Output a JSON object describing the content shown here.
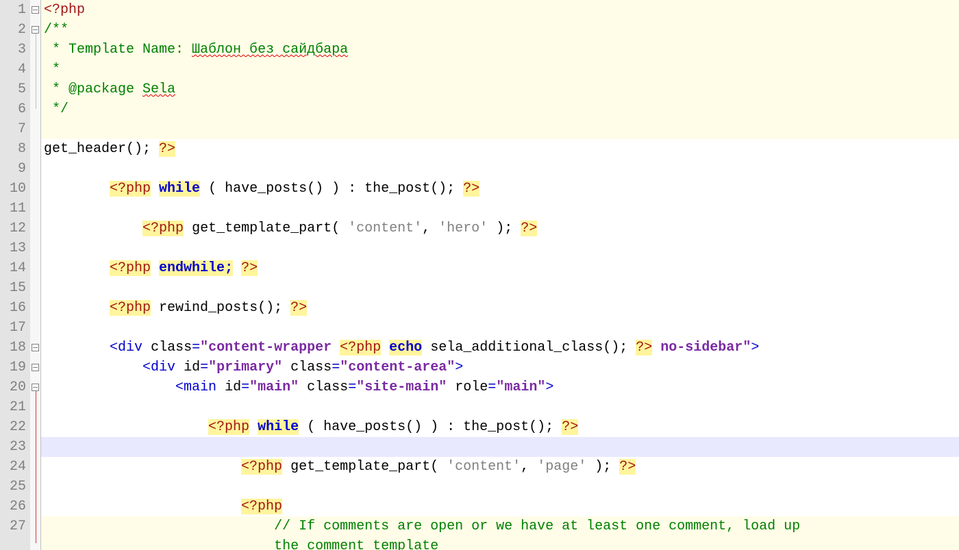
{
  "lines": {
    "open_tag": "<?php",
    "c1": "/**",
    "c2_prefix": " * Template Name: ",
    "c2_boxed": "Шаблон без сайдбара",
    "c3": " *",
    "c4_prefix": " * @package ",
    "c4_pkg": "Sela",
    "c5": " */",
    "l8_func": "get_header",
    "l8_rest": "(); ",
    "l8_close": "?>",
    "while_kw": "while",
    "have_posts": "have_posts",
    "the_post": "the_post",
    "get_template_part": "get_template_part",
    "content_str": "'content'",
    "hero_str": "'hero'",
    "page_str": "'page'",
    "endwhile": "endwhile;",
    "rewind_posts": "rewind_posts",
    "echo_kw": "echo",
    "sela_fn": "sela_additional_class",
    "no_sidebar": " no-sidebar",
    "div": "div",
    "main": "main",
    "class_attr": "class",
    "id_attr": "id",
    "role_attr": "role",
    "content_wrapper": "content-wrapper ",
    "primary": "primary",
    "content_area": "content-area",
    "main_val": "main",
    "site_main": "site-main",
    "comment1": "// If comments are open or we have at least one comment, load up",
    "comment2": "the comment template"
  },
  "line_numbers": [
    "1",
    "2",
    "3",
    "4",
    "5",
    "6",
    "7",
    "8",
    "9",
    "10",
    "11",
    "12",
    "13",
    "14",
    "15",
    "16",
    "17",
    "18",
    "19",
    "20",
    "21",
    "22",
    "23",
    "24",
    "25",
    "26",
    "27"
  ],
  "fold": {
    "minus_rows": [
      0,
      1,
      17,
      18,
      19
    ],
    "comment_block": {
      "start": 1,
      "end": 5
    },
    "red_block": {
      "start": 19,
      "end": 26
    }
  }
}
